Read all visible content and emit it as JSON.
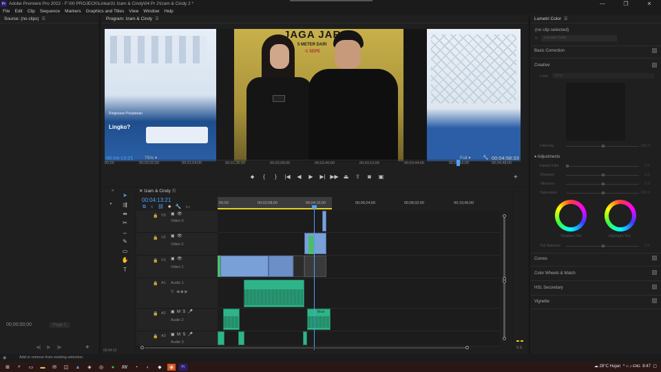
{
  "app": {
    "logo_text": "Pr",
    "title": "Adobe Premiere Pro 2022 - F:\\00 PROJECK\\Linka\\31 Izam & Cindy\\04 Pr 2\\Izam & Cindy 2 *",
    "window_controls": [
      "—",
      "❐",
      "✕"
    ]
  },
  "menu": [
    "File",
    "Edit",
    "Clip",
    "Sequence",
    "Markers",
    "Graphics and Titles",
    "View",
    "Window",
    "Help"
  ],
  "source": {
    "title": "Source: (no clips)",
    "timecode": "00;00;00;00",
    "page": "Page 1"
  },
  "program": {
    "title": "Program: Izam & Cindy",
    "timecode": "00:04:13:21",
    "zoom": "75%",
    "resolution": "Full",
    "duration": "00:04:58:33",
    "poster_top_text": "JAGA JAR",
    "poster_sub_text": "5 METER DARI",
    "poster_small": "-1 SEPE",
    "left_panel_text": [
      "Ringkasan Perjalanan",
      "Lingko?"
    ],
    "ruler_ticks": [
      "00;00",
      "00;00;32;00",
      "00;01;04;00",
      "00;01;36;00",
      "00;02;08;00",
      "00;02;40;00",
      "00;03;12;00",
      "00;03;44;00",
      "00;04;16;00",
      "00;04;48;00"
    ],
    "playhead_fraction": 0.85
  },
  "lumetri": {
    "title": "Lumetri Color",
    "no_clip": "(no clip selected)",
    "fx": "fx",
    "dropdown": "Lumetri Color",
    "sections": {
      "basic": "Basic Correction",
      "creative": "Creative",
      "curves": "Curves",
      "wheels": "Color Wheels & Match",
      "hsl": "HSL Secondary",
      "vignette": "Vignette",
      "adjustments": "Adjustments"
    },
    "look_label": "Look",
    "look_value": "None",
    "intensity": {
      "label": "Intensity",
      "value": "100.0"
    },
    "sliders": [
      {
        "label": "Faded Film",
        "value": "0.0"
      },
      {
        "label": "Sharpen",
        "value": "0.0"
      },
      {
        "label": "Vibrance",
        "value": "0.0"
      },
      {
        "label": "Saturation",
        "value": "100.0"
      }
    ],
    "shadow_tint": "Shadow Tint",
    "highlight_tint": "Highlight Tint",
    "tint_balance": {
      "label": "Tint Balance",
      "value": "0.0"
    }
  },
  "timeline": {
    "title": "Izam & Cindy",
    "timecode": "00:04:13:21",
    "ruler_ticks": [
      "00;00",
      "00;02;08;00",
      "00;04;16;00",
      "00;06;24;00",
      "00;08;32;00",
      "00;10;40;00"
    ],
    "tracks": [
      {
        "id": "V3",
        "name": "Video 3"
      },
      {
        "id": "V2",
        "name": "Video 2"
      },
      {
        "id": "V1",
        "name": "Video 1"
      },
      {
        "id": "A1",
        "name": "Audio 1"
      },
      {
        "id": "A2",
        "name": "Audio 2"
      },
      {
        "id": "A3",
        "name": "Audio 3"
      }
    ],
    "clip_label": "Brun",
    "bottom_tc": "00:04:13"
  },
  "status": {
    "text": "Add or remove from existing selection."
  },
  "taskbar": {
    "weather": "28°C  Hujan",
    "time": "8:47",
    "lang": "ENG"
  },
  "colors": {
    "accent": "#4da3ff",
    "video_clip": "#7aa0d8",
    "audio_clip": "#2fb48a",
    "work_area": "#e9d21e"
  }
}
